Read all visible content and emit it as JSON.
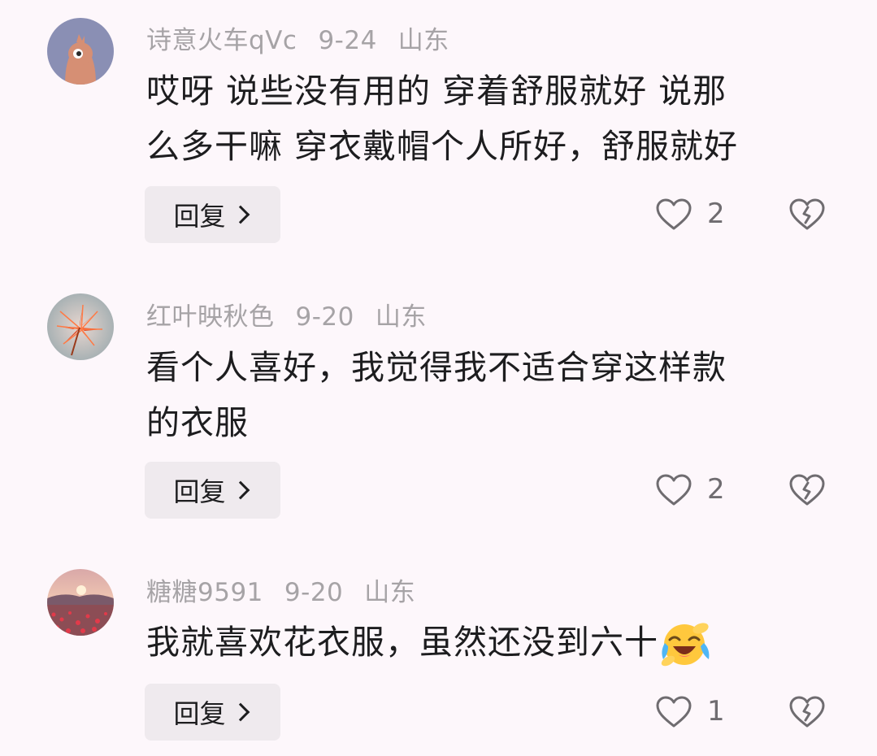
{
  "comments": [
    {
      "username": "诗意火车qVc",
      "date": "9-24",
      "location": "山东",
      "text_lines": [
        "哎呀 说些没有用的 穿着舒服就好 说那",
        "么多干嘛 穿衣戴帽个人所好，舒服就好"
      ],
      "reply_label": "回复",
      "likes": "2",
      "avatar": "cartoon-avatar"
    },
    {
      "username": "红叶映秋色",
      "date": "9-20",
      "location": "山东",
      "text_lines": [
        "看个人喜好，我觉得我不适合穿这样款",
        "的衣服"
      ],
      "reply_label": "回复",
      "likes": "2",
      "avatar": "red-leaf-avatar"
    },
    {
      "username": "糖糖9591",
      "date": "9-20",
      "location": "山东",
      "text_lines": [
        "我就喜欢花衣服，虽然还没到六十"
      ],
      "emoji": "laughing-crying-emoji",
      "reply_label": "回复",
      "likes": "1",
      "avatar": "flower-field-avatar"
    }
  ],
  "icons": {
    "like": "heart-outline-icon",
    "dislike": "broken-heart-icon",
    "reply_chevron": "chevron-right-icon"
  },
  "colors": {
    "background": "#fdf7fb",
    "meta_text": "#a6a3a6",
    "body_text": "#1d1d1f",
    "button_bg": "#efeaee",
    "icon": "#6f6c70"
  }
}
